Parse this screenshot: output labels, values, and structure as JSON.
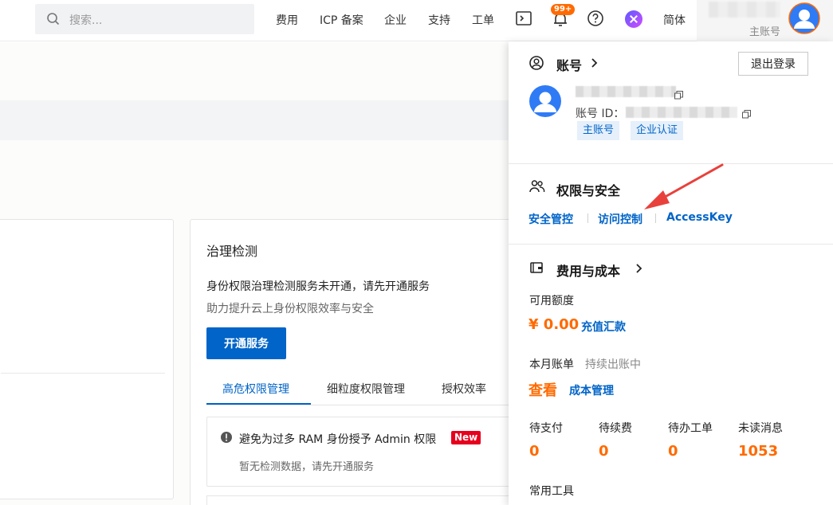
{
  "topbar": {
    "search_placeholder": "搜索...",
    "nav": [
      "费用",
      "ICP 备案",
      "企业",
      "支持",
      "工单"
    ],
    "notification_badge": "99+",
    "language": "简体",
    "account_role": "主账号"
  },
  "main": {
    "card_title": "治理检测",
    "desc1": "身份权限治理检测服务未开通，请先开通服务",
    "desc2": "助力提升云上身份权限效率与安全",
    "open_button": "开通服务",
    "tabs": [
      "高危权限管理",
      "细粒度权限管理",
      "授权效率"
    ],
    "alert_text": "避免为过多 RAM 身份授予 Admin 权限",
    "alert_badge": "New",
    "alert_sub": "暂无检测数据，请先开通服务"
  },
  "panel": {
    "account_title": "账号",
    "logout": "退出登录",
    "account_id_label": "账号 ID：",
    "tags": [
      "主账号",
      "企业认证"
    ],
    "security_title": "权限与安全",
    "security_links": [
      "安全管控",
      "访问控制",
      "AccessKey"
    ],
    "billing_title": "费用与成本",
    "available_label": "可用额度",
    "available_value": "¥ 0.00",
    "recharge_link": "充值汇款",
    "bill_label": "本月账单",
    "bill_status": "持续出账中",
    "view_link": "查看",
    "cost_link": "成本管理",
    "stats": [
      {
        "label": "待支付",
        "value": "0"
      },
      {
        "label": "待续费",
        "value": "0"
      },
      {
        "label": "待办工单",
        "value": "0"
      },
      {
        "label": "未读消息",
        "value": "1053"
      }
    ],
    "tools_title": "常用工具"
  },
  "colors": {
    "brand_blue": "#0064c8",
    "accent_orange": "#ff6a00",
    "annotation_red": "#e8413c"
  }
}
